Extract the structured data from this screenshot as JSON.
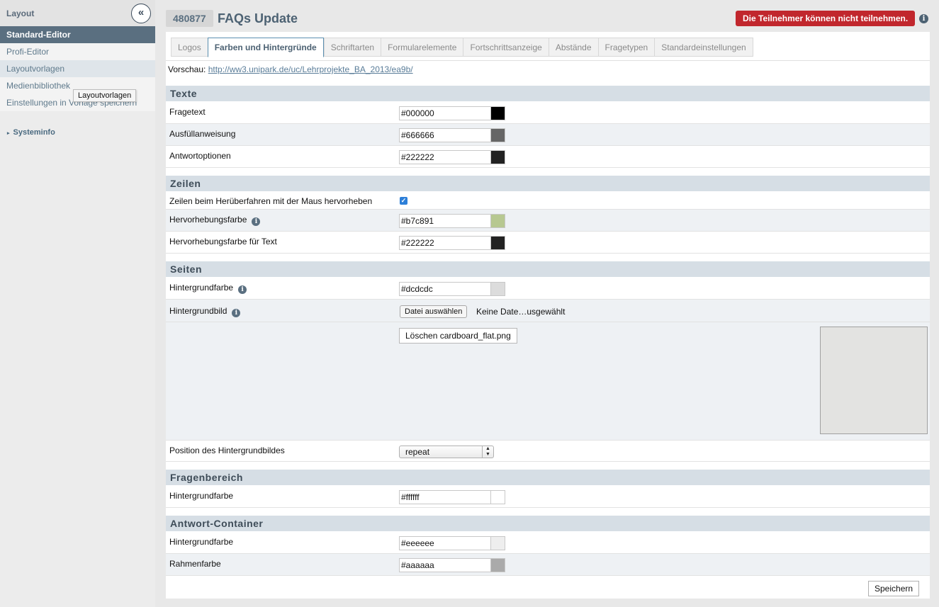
{
  "sidebar": {
    "header": "Layout",
    "collapse_icon": "«",
    "items": [
      {
        "label": "Standard-Editor"
      },
      {
        "label": "Profi-Editor"
      },
      {
        "label": "Layoutvorlagen"
      },
      {
        "label": "Medienbibliothek"
      },
      {
        "label": "Einstellungen in Vorlage speichern"
      }
    ],
    "tooltip": "Layoutvorlagen",
    "systeminfo": "Systeminfo",
    "systeminfo_caret": "▸"
  },
  "header": {
    "survey_id": "480877",
    "title": "FAQs Update",
    "alert": "Die Teilnehmer können nicht teilnehmen.",
    "info_icon": "i"
  },
  "tabs": [
    {
      "label": "Logos"
    },
    {
      "label": "Farben und Hintergründe"
    },
    {
      "label": "Schriftarten"
    },
    {
      "label": "Formularelemente"
    },
    {
      "label": "Fortschrittsanzeige"
    },
    {
      "label": "Abstände"
    },
    {
      "label": "Fragetypen"
    },
    {
      "label": "Standardeinstellungen"
    }
  ],
  "preview": {
    "label": "Vorschau:",
    "url": "http://ww3.unipark.de/uc/Lehrprojekte_BA_2013/ea9b/"
  },
  "sections": {
    "texte": {
      "title": "Texte",
      "rows": [
        {
          "label": "Fragetext",
          "value": "#000000",
          "swatch": "#000000"
        },
        {
          "label": "Ausfüllanweisung",
          "value": "#666666",
          "swatch": "#666666"
        },
        {
          "label": "Antwortoptionen",
          "value": "#222222",
          "swatch": "#222222"
        }
      ]
    },
    "zeilen": {
      "title": "Zeilen",
      "hover_label": "Zeilen beim Herüberfahren mit der Maus hervorheben",
      "hover_checked": "✓",
      "rows": [
        {
          "label": "Hervorhebungsfarbe",
          "value": "#b7c891",
          "swatch": "#b7c891"
        },
        {
          "label": "Hervorhebungsfarbe für Text",
          "value": "#222222",
          "swatch": "#222222"
        }
      ]
    },
    "seiten": {
      "title": "Seiten",
      "bg_color_label": "Hintergrundfarbe",
      "bg_color_value": "#dcdcdc",
      "bg_color_swatch": "#dcdcdc",
      "bg_image_label": "Hintergrundbild",
      "file_button": "Datei auswählen",
      "file_status": "Keine Date…usgewählt",
      "delete_button": "Löschen cardboard_flat.png",
      "position_label": "Position des Hintergrundbildes",
      "position_value": "repeat"
    },
    "fragenbereich": {
      "title": "Fragenbereich",
      "rows": [
        {
          "label": "Hintergrundfarbe",
          "value": "#ffffff",
          "swatch": "#ffffff"
        }
      ]
    },
    "antwort": {
      "title": "Antwort-Container",
      "rows": [
        {
          "label": "Hintergrundfarbe",
          "value": "#eeeeee",
          "swatch": "#eeeeee"
        },
        {
          "label": "Rahmenfarbe",
          "value": "#aaaaaa",
          "swatch": "#aaaaaa"
        }
      ]
    }
  },
  "info_glyph": "i",
  "save_button": "Speichern"
}
